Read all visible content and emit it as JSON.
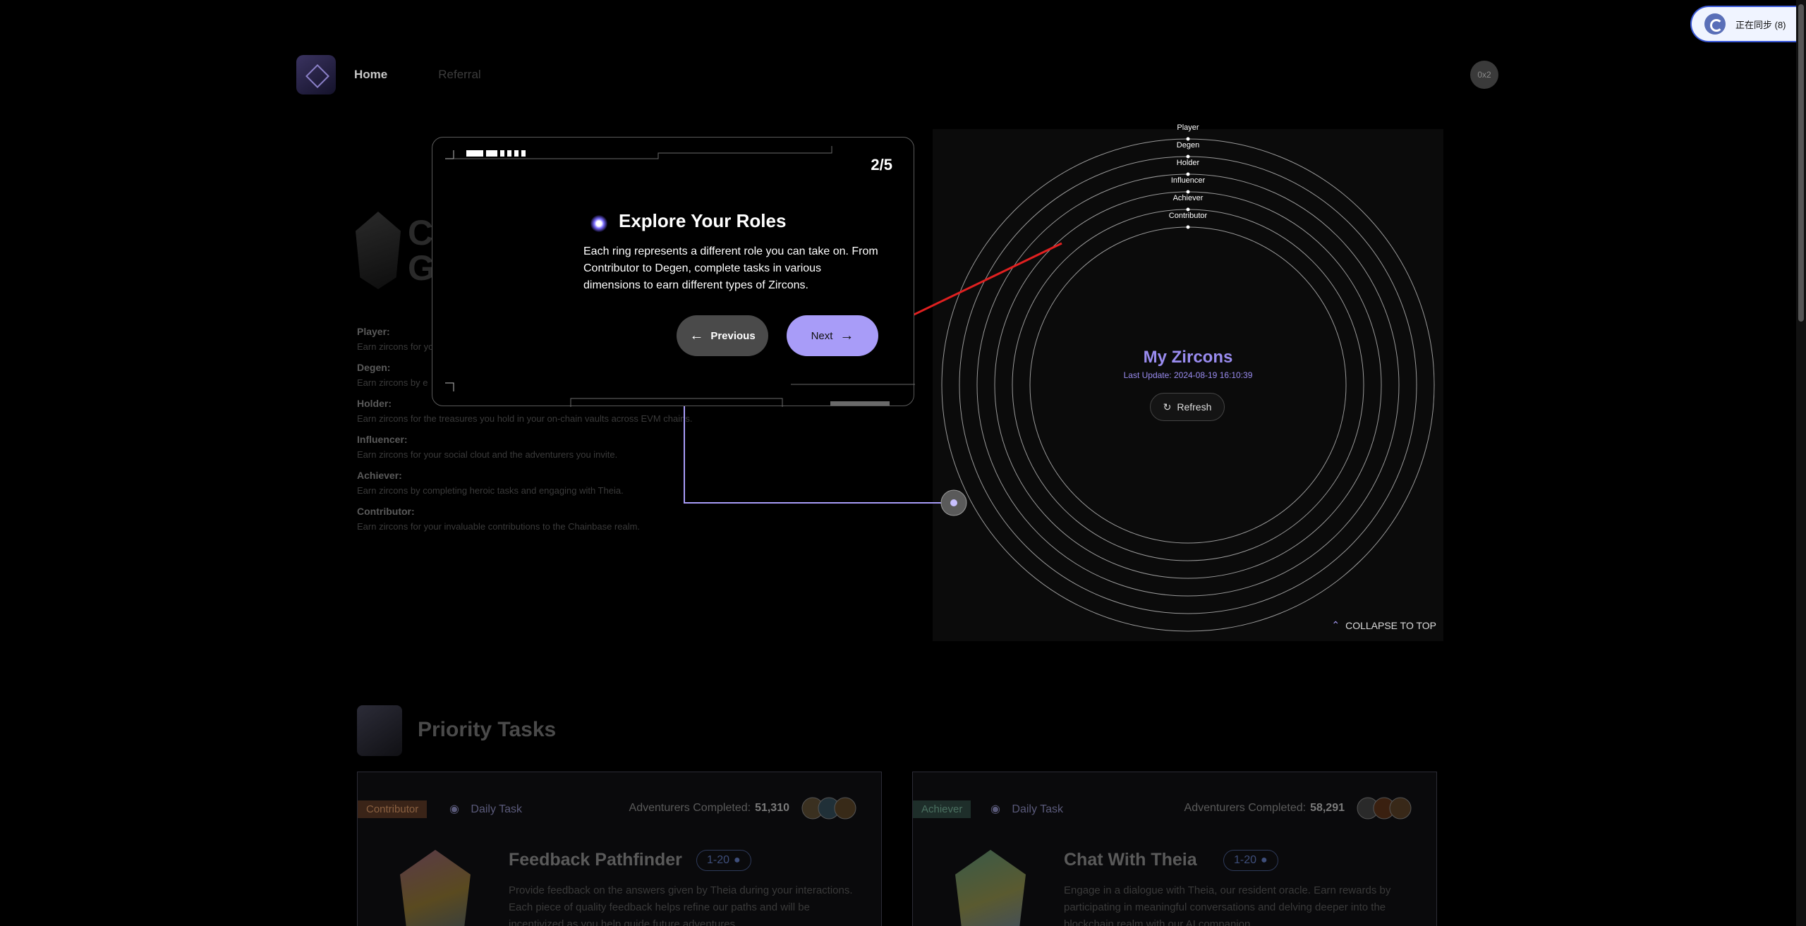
{
  "header": {
    "nav_home": "Home",
    "nav_referral": "Referral",
    "wallet_label": "0x2"
  },
  "sync": {
    "label": "正在同步 (8)"
  },
  "left": {
    "title_line1": "C",
    "title_line2": "G",
    "roles": [
      {
        "name": "Player:",
        "desc": "Earn zircons for yo"
      },
      {
        "name": "Degen:",
        "desc": "Earn zircons by e"
      },
      {
        "name": "Holder:",
        "desc": "Earn zircons for the treasures you hold in your on-chain vaults across EVM chains."
      },
      {
        "name": "Influencer:",
        "desc": "Earn zircons for your social clout and the adventurers you invite."
      },
      {
        "name": "Achiever:",
        "desc": "Earn zircons by completing heroic tasks and engaging with Theia."
      },
      {
        "name": "Contributor:",
        "desc": "Earn zircons for your invaluable contributions to the Chainbase realm."
      }
    ]
  },
  "zircons": {
    "ring_labels": [
      "Player",
      "Degen",
      "Holder",
      "Influencer",
      "Achiever",
      "Contributor"
    ],
    "title": "My Zircons",
    "last_update": "Last Update: 2024-08-19 16:10:39",
    "refresh_label": "Refresh",
    "collapse_label": "COLLAPSE TO TOP"
  },
  "priority": {
    "title": "Priority Tasks",
    "cards": [
      {
        "tag": "Contributor",
        "daily": "Daily Task",
        "adventurers_label": "Adventurers Completed:",
        "adventurers_count": "51,310",
        "name": "Feedback Pathfinder",
        "range": "1-20",
        "desc": "Provide feedback on the answers given by Theia during your interactions. Each piece of quality feedback helps refine our paths and will be incentivized as you help guide future adventures."
      },
      {
        "tag": "Achiever",
        "daily": "Daily Task",
        "adventurers_label": "Adventurers Completed:",
        "adventurers_count": "58,291",
        "name": "Chat With Theia",
        "range": "1-20",
        "desc": "Engage in a dialogue with Theia, our resident oracle. Earn rewards by participating in meaningful conversations and delving deeper into the blockchain realm with our AI companion."
      }
    ]
  },
  "modal": {
    "step": "2/5",
    "title": "Explore Your Roles",
    "text": "Each ring represents a different role you can take on. From Contributor to Degen, complete tasks in various dimensions to earn different types of Zircons.",
    "prev_label": "Previous",
    "next_label": "Next"
  },
  "colors": {
    "accent": "#a89cf8",
    "contributor_tag": "#3a2418",
    "achiever_tag": "#1e2e2a",
    "arrow": "#e02020"
  }
}
